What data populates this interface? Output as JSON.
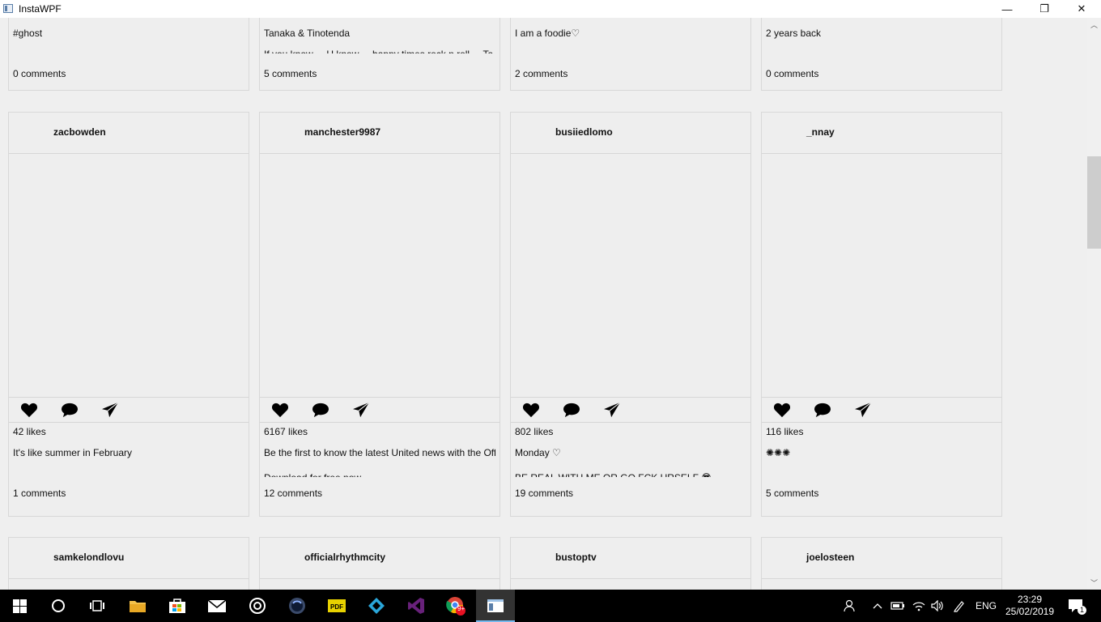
{
  "window": {
    "title": "InstaWPF",
    "minimize": "—",
    "restore": "❐",
    "close": "✕"
  },
  "top_row": [
    {
      "caption": "#ghost",
      "caption2": "",
      "comments": "0 comments"
    },
    {
      "caption": "Tanaka & Tinotenda",
      "caption2": "If you know ... U know ... happy times rock n roll ... Ta",
      "comments": "5 comments"
    },
    {
      "caption": "I am a foodie♡",
      "caption2": "",
      "comments": "2 comments"
    },
    {
      "caption": "2 years back",
      "caption2": "",
      "comments": "0 comments"
    }
  ],
  "mid_row": [
    {
      "username": "zacbowden",
      "likes": "42 likes",
      "caption": "It's like summer in February",
      "caption2": "",
      "comments": "1 comments"
    },
    {
      "username": "manchester9987",
      "likes": "6167 likes",
      "caption": "Be the first to know the latest United news with the Off",
      "caption2": "Download for free now",
      "comments": "12 comments"
    },
    {
      "username": "busiiedlomo",
      "likes": "802 likes",
      "caption": "Monday ♡",
      "caption2": "BE REAL WITH ME OR GO FCK URSELF 😎",
      "comments": "19 comments"
    },
    {
      "username": "_nnay",
      "likes": "116 likes",
      "caption": "✺✺✺",
      "caption2": "",
      "comments": "5 comments"
    }
  ],
  "bottom_row": [
    {
      "username": "samkelondlovu"
    },
    {
      "username": "officialrhythmcity"
    },
    {
      "username": "bustoptv"
    },
    {
      "username": "joelosteen"
    }
  ],
  "taskbar": {
    "language": "ENG",
    "time": "23:29",
    "date": "25/02/2019",
    "notification_count": "1",
    "chrome_badge": "9+",
    "icons": [
      "windows-start-icon",
      "cortana-icon",
      "task-view-icon",
      "file-explorer-icon",
      "store-icon",
      "mail-icon",
      "media-player-icon",
      "cinema4d-icon",
      "pdf-icon",
      "kodi-icon",
      "visual-studio-icon",
      "chrome-icon",
      "instawpf-app-icon"
    ]
  },
  "colors": {
    "taskbar": "#000000",
    "card_bg": "#eeeeee",
    "border": "#d8d8d8",
    "scroll_thumb": "#cdcdcd"
  }
}
